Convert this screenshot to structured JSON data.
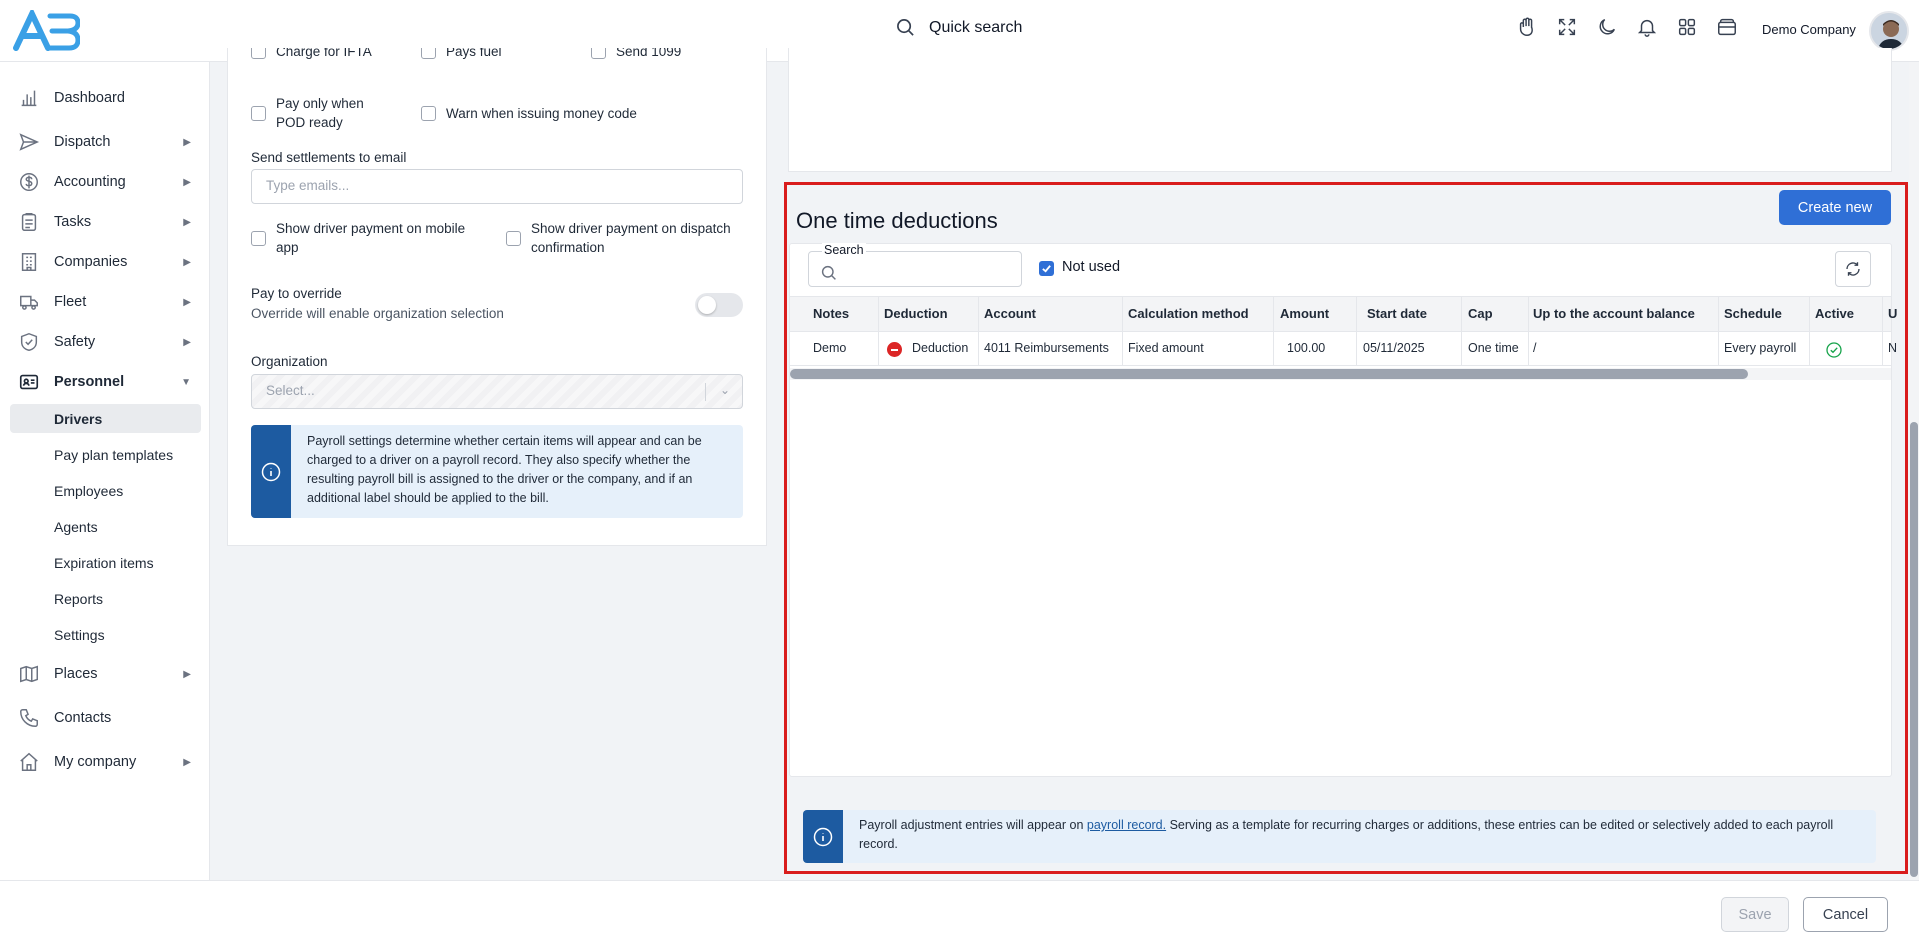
{
  "header": {
    "search_label": "Quick search",
    "company": "Demo Company",
    "icons": [
      "hand-icon",
      "fullscreen-icon",
      "moon-icon",
      "bell-icon",
      "apps-grid-icon",
      "wallet-icon"
    ]
  },
  "sidebar": {
    "items": [
      {
        "label": "Dashboard"
      },
      {
        "label": "Dispatch"
      },
      {
        "label": "Accounting"
      },
      {
        "label": "Tasks"
      },
      {
        "label": "Companies"
      },
      {
        "label": "Fleet"
      },
      {
        "label": "Safety"
      },
      {
        "label": "Personnel"
      },
      {
        "label": "Places"
      },
      {
        "label": "Contacts"
      },
      {
        "label": "My company"
      }
    ],
    "personnel_sub": [
      "Drivers",
      "Pay plan templates",
      "Employees",
      "Agents",
      "Expiration items",
      "Reports",
      "Settings"
    ]
  },
  "settings": {
    "top_checks": [
      "Charge for IFTA",
      "Pays fuel",
      "Send 1099"
    ],
    "pay_only_pod": "Pay only when POD ready",
    "warn_money_code": "Warn when issuing money code",
    "send_settlements_label": "Send settlements to email",
    "emails_placeholder": "Type emails...",
    "show_mobile": "Show driver payment on mobile app",
    "show_dispatch": "Show driver payment on dispatch confirmation",
    "pay_override_label": "Pay to override",
    "pay_override_hint": "Override will enable organization selection",
    "organization_label": "Organization",
    "organization_placeholder": "Select...",
    "info_text": "Payroll settings determine whether certain items will appear and can be charged to a driver on a payroll record. They also specify whether the resulting payroll bill is assigned to the driver or the company, and if an additional label should be applied to the bill."
  },
  "deductions": {
    "title": "One time deductions",
    "create_label": "Create new",
    "search_label": "Search",
    "not_used_label": "Not used",
    "not_used_checked": true,
    "columns": [
      "Notes",
      "Deduction",
      "Account",
      "Calculation method",
      "Amount",
      "Start date",
      "Cap",
      "Up to the account balance",
      "Schedule",
      "Active",
      "U"
    ],
    "rows": [
      {
        "notes": "Demo",
        "deduction": "Deduction",
        "account": "4011 Reimbursements",
        "calc": "Fixed amount",
        "amount": "100.00",
        "start": "05/11/2025",
        "cap": "One time",
        "up_to": "/",
        "schedule": "Every payroll",
        "active": true,
        "extra": "N"
      }
    ],
    "info_before": "Payroll adjustment entries will appear on ",
    "info_link": "payroll record.",
    "info_after": " Serving as a template for recurring charges or additions, these entries can be edited or selectively added to each payroll record."
  },
  "footer": {
    "save_label": "Save",
    "cancel_label": "Cancel"
  },
  "colors": {
    "accent": "#2f6fd6",
    "info_bar": "#1d5ba1",
    "highlight": "#d91c1c",
    "deduction_badge": "#dc2626",
    "active_check": "#16a34a"
  }
}
